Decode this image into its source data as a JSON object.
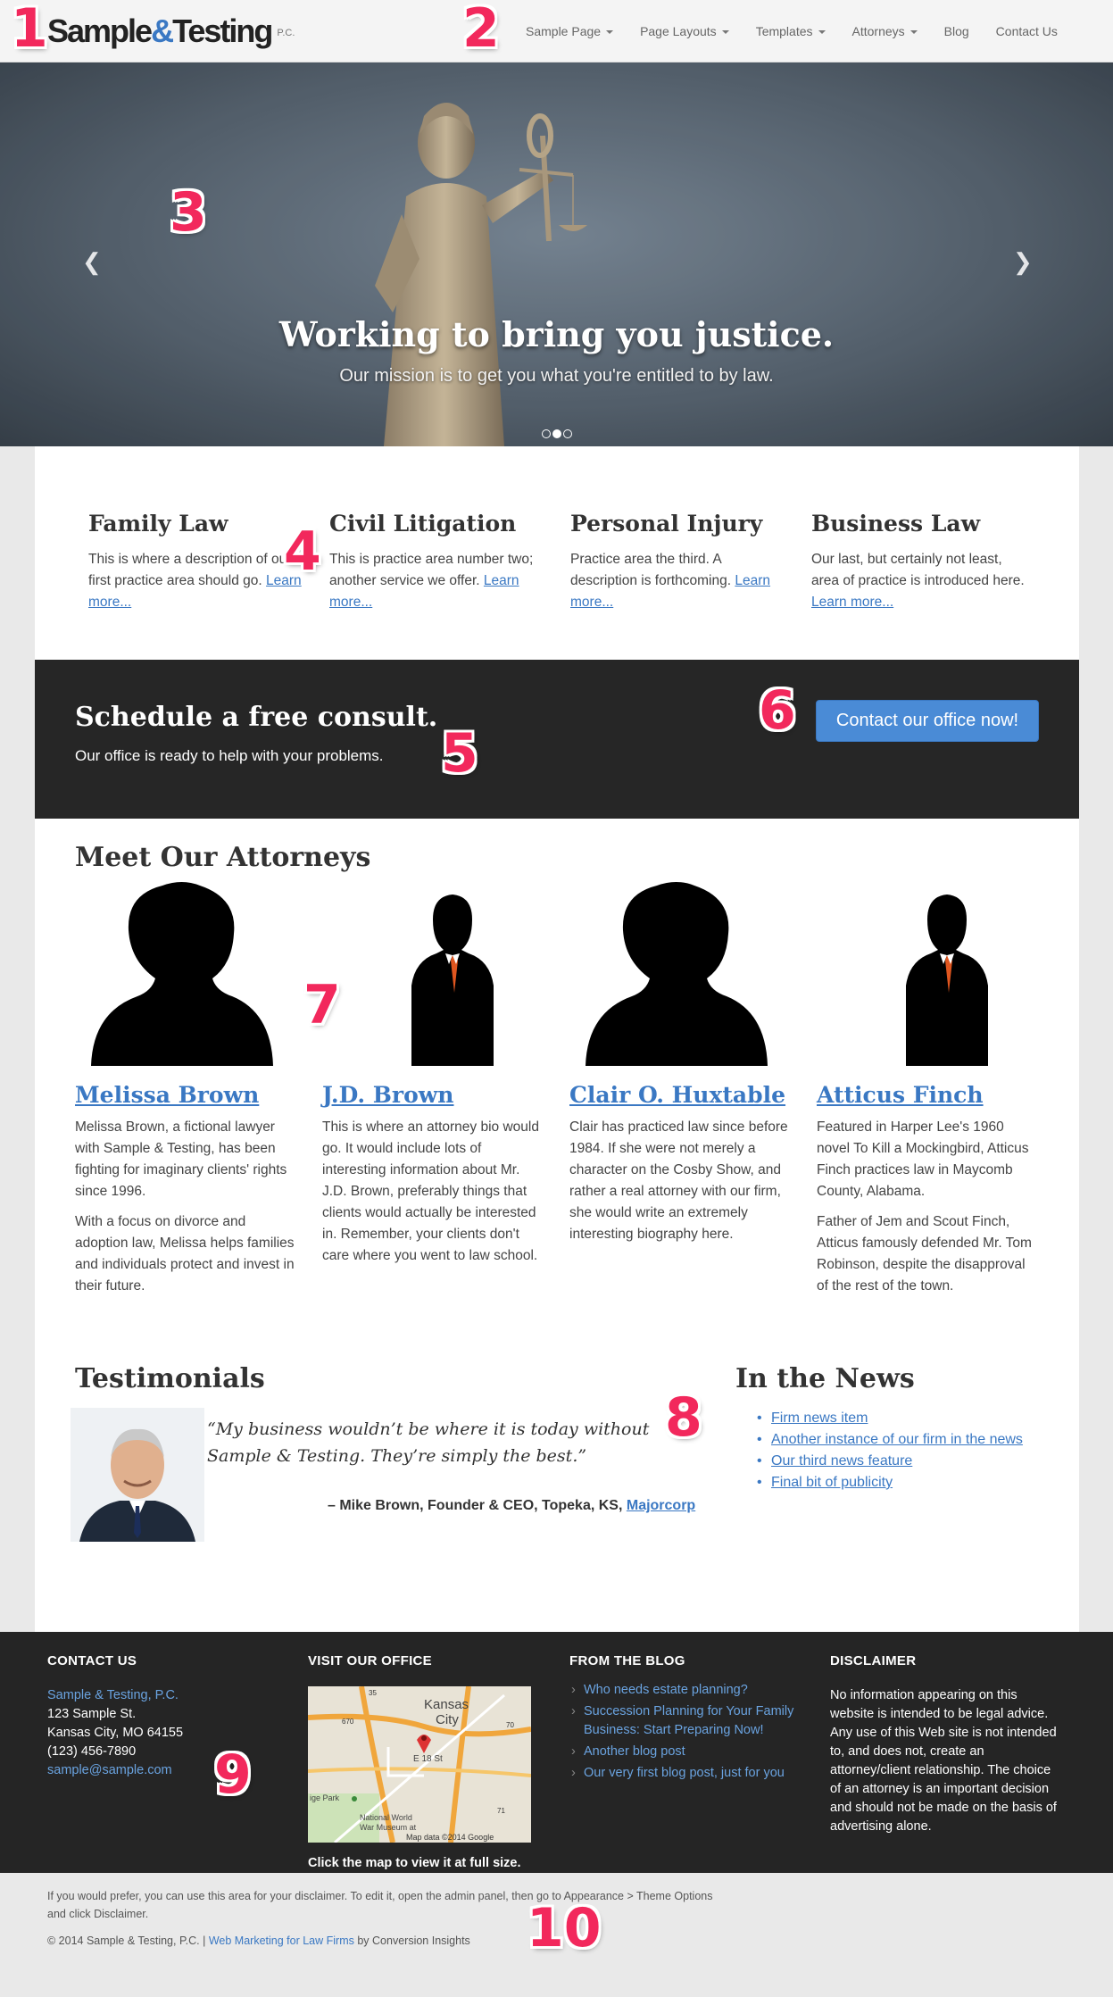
{
  "brand": {
    "name_part1": "Sample",
    "amp": "&",
    "name_part2": "Testing",
    "suffix": "P.C."
  },
  "nav": [
    {
      "label": "Sample Page",
      "dropdown": true
    },
    {
      "label": "Page Layouts",
      "dropdown": true
    },
    {
      "label": "Templates",
      "dropdown": true
    },
    {
      "label": "Attorneys",
      "dropdown": true
    },
    {
      "label": "Blog",
      "dropdown": false
    },
    {
      "label": "Contact Us",
      "dropdown": false
    }
  ],
  "hero": {
    "heading": "Working to bring you justice.",
    "subheading": "Our mission is to get you what you're entitled to by law.",
    "prev_icon": "chevron-left-icon",
    "next_icon": "chevron-right-icon",
    "slides": 3,
    "active_slide": 2
  },
  "practice_areas": [
    {
      "title": "Family Law",
      "text": "This is where a description of our first practice area should go. ",
      "link": "Learn more..."
    },
    {
      "title": "Civil Litigation",
      "text": "This is practice area number two; another service we offer. ",
      "link": "Learn more..."
    },
    {
      "title": "Personal Injury",
      "text": "Practice area the third. A description is forthcoming. ",
      "link": "Learn more..."
    },
    {
      "title": "Business Law",
      "text": "Our last, but certainly not least, area of practice is introduced here. ",
      "link": "Learn more..."
    }
  ],
  "cta": {
    "heading": "Schedule a free consult.",
    "text": "Our office is ready to help with your problems.",
    "button": "Contact our office now!"
  },
  "attorneys_section": {
    "title": "Meet Our Attorneys",
    "attorneys": [
      {
        "name": "Melissa Brown",
        "photo": "female-silhouette",
        "paragraphs": [
          "Melissa Brown, a fictional lawyer with Sample & Testing, has been fighting for imaginary clients' rights since 1996.",
          "With a focus on divorce and adoption law, Melissa helps families and individuals protect and invest in their future."
        ]
      },
      {
        "name": "J.D. Brown",
        "photo": "male-silhouette",
        "paragraphs": [
          "This is where an attorney bio would go. It would include lots of interesting information about Mr. J.D. Brown, preferably things that clients would actually be interested in. Remember, your clients don't care where you went to law school.",
          ""
        ]
      },
      {
        "name": "Clair O. Huxtable",
        "photo": "female-silhouette",
        "paragraphs": [
          "Clair has practiced law since before 1984. If she were not merely a character on the Cosby Show, and rather a real attorney with our firm, she would write an extremely interesting biography here.",
          ""
        ]
      },
      {
        "name": "Atticus Finch",
        "photo": "male-silhouette",
        "paragraphs": [
          "Featured in Harper Lee's 1960 novel To Kill a Mockingbird, Atticus Finch practices law in Maycomb County, Alabama.",
          "Father of Jem and Scout Finch, Atticus famously defended Mr. Tom Robinson, despite the disapproval of the rest of the town."
        ]
      }
    ]
  },
  "testimonials": {
    "title": "Testimonials",
    "quote": "“My business wouldn’t be where it is today without Sample & Testing. They’re simply the best.”",
    "attribution": "– Mike Brown, Founder & CEO, Topeka, KS, ",
    "company": "Majorcorp"
  },
  "news": {
    "title": "In the News",
    "items": [
      "Firm news item",
      "Another instance of our firm in the news",
      "Our third news feature",
      "Final bit of publicity"
    ]
  },
  "footer": {
    "contact": {
      "heading": "Contact Us",
      "firm": "Sample & Testing, P.C.",
      "street": "123 Sample St.",
      "city": "Kansas City, MO 64155",
      "phone": "(123) 456-7890",
      "email": "sample@sample.com"
    },
    "office": {
      "heading": "Visit Our Office",
      "caption": "Click the map to view it at full size.",
      "map_labels": {
        "city1": "Kansas",
        "city2": "City",
        "street": "E 18 St",
        "park": "ige Park",
        "museum1": "National World",
        "museum2": "War Museum at",
        "attribution": "Map data ©2014 Google",
        "route1": "35",
        "route2": "670",
        "route3": "70",
        "route4": "71"
      }
    },
    "blog": {
      "heading": "From the Blog",
      "posts": [
        "Who needs estate planning?",
        "Succession Planning for Your Family Business: Start Preparing Now!",
        "Another blog post",
        "Our very first blog post, just for you"
      ]
    },
    "disclaimer": {
      "heading": "Disclaimer",
      "text": "No information appearing on this website is intended to be legal advice. Any use of this Web site is not intended to, and does not, create an attorney/client relationship. The choice of an attorney is an important decision and should not be made on the basis of advertising alone."
    }
  },
  "subfooter": {
    "disclaimer_text": "If you would prefer, you can use this area for your disclaimer. To edit it, open the admin panel, then go to Appearance > Theme Options and click Disclaimer.",
    "copyright": "© 2014 Sample & Testing, P.C. | ",
    "link": "Web Marketing for Law Firms",
    "by": " by Conversion Insights"
  },
  "markers": [
    "1",
    "2",
    "3",
    "4",
    "5",
    "6",
    "7",
    "8",
    "9",
    "10"
  ],
  "colors": {
    "accent": "#3a78c3",
    "button": "#4a8bd6",
    "marker": "#f2285c",
    "dark": "#262626"
  }
}
